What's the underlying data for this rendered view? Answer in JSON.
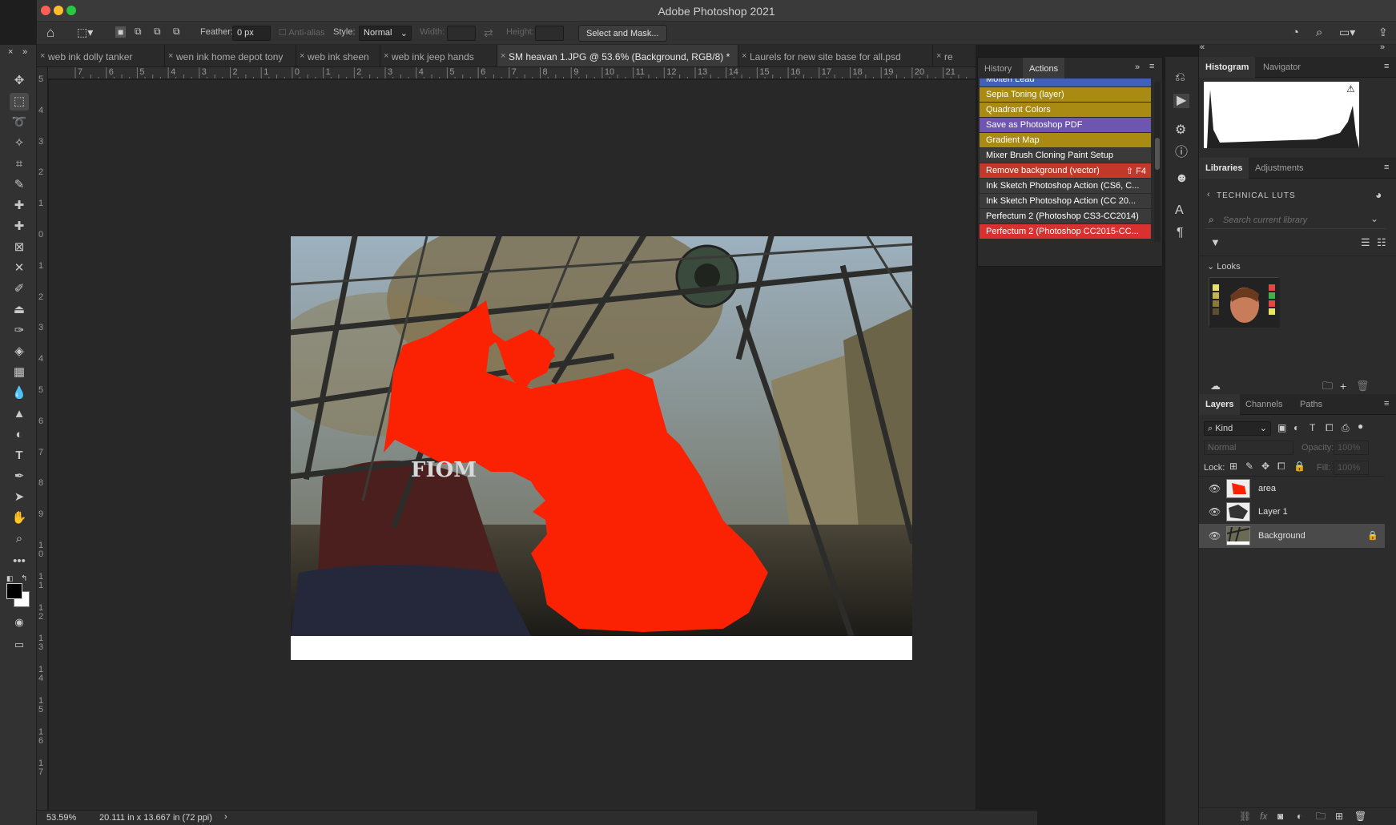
{
  "app": {
    "title": "Adobe Photoshop 2021"
  },
  "options": {
    "feather_label": "Feather:",
    "feather_value": "0 px",
    "antialias_label": "Anti-alias",
    "style_label": "Style:",
    "style_value": "Normal",
    "width_label": "Width:",
    "height_label": "Height:",
    "select_mask_label": "Select and Mask..."
  },
  "tabs": [
    {
      "label": "web ink dolly tanker",
      "active": false
    },
    {
      "label": "wen ink home depot tony",
      "active": false
    },
    {
      "label": "web ink sheen",
      "active": false
    },
    {
      "label": "web ink jeep hands",
      "active": false
    },
    {
      "label": "SM heavan 1.JPG @ 53.6% (Background, RGB/8) *",
      "active": true
    },
    {
      "label": "Laurels for new site base for all.psd",
      "active": false
    },
    {
      "label": "re",
      "active": false
    }
  ],
  "ruler": {
    "h": [
      "7",
      "6",
      "5",
      "4",
      "3",
      "2",
      "1",
      "0",
      "1",
      "2",
      "3",
      "4",
      "5",
      "6",
      "7",
      "8",
      "9",
      "10",
      "11",
      "12",
      "13",
      "14",
      "15",
      "16",
      "17",
      "18",
      "19",
      "20",
      "21"
    ],
    "v": [
      "5",
      "4",
      "3",
      "2",
      "1",
      "0",
      "1",
      "2",
      "3",
      "4",
      "5",
      "6",
      "7",
      "8",
      "9",
      "1 0",
      "1 1",
      "1 2",
      "1 3",
      "1 4",
      "1 5",
      "1 6",
      "1 7"
    ]
  },
  "status": {
    "zoom": "53.59%",
    "doc_size": "20.111 in x 13.667 in (72 ppi)"
  },
  "actions_panel": {
    "tabs": [
      "History",
      "Actions"
    ],
    "items": [
      {
        "label": "Molten Lead",
        "color": "#3f62b8"
      },
      {
        "label": "Sepia Toning (layer)",
        "color": "#a98a12"
      },
      {
        "label": "Quadrant Colors",
        "color": "#a98a12"
      },
      {
        "label": "Save as Photoshop PDF",
        "color": "#6d55b0"
      },
      {
        "label": "Gradient Map",
        "color": "#a98a12"
      },
      {
        "label": "Mixer Brush Cloning Paint Setup",
        "color": "#3a3a3a"
      },
      {
        "label": "Remove background (vector)",
        "color": "#c0392b",
        "shortcut": "⇧ F4"
      },
      {
        "label": "Ink Sketch Photoshop Action (CS6, C...",
        "color": "#3a3a3a"
      },
      {
        "label": "Ink Sketch Photoshop Action  (CC 20...",
        "color": "#3a3a3a"
      },
      {
        "label": "Perfectum 2 (Photoshop CS3-CC2014)",
        "color": "#3a3a3a"
      },
      {
        "label": "Perfectum 2 (Photoshop CC2015-CC...",
        "color": "#d93030"
      }
    ]
  },
  "histogram_panel": {
    "tabs": [
      "Histogram",
      "Navigator"
    ]
  },
  "libraries_panel": {
    "tabs": [
      "Libraries",
      "Adjustments"
    ],
    "library_name": "TECHNICAL LUTS",
    "search_placeholder": "Search current library",
    "section": "Looks"
  },
  "layers_panel": {
    "tabs": [
      "Layers",
      "Channels",
      "Paths"
    ],
    "kind_label": "Kind",
    "blend_mode": "Normal",
    "opacity_label": "Opacity:",
    "opacity_value": "100%",
    "lock_label": "Lock:",
    "fill_label": "Fill:",
    "fill_value": "100%",
    "layers": [
      {
        "name": "area"
      },
      {
        "name": "Layer 1"
      },
      {
        "name": "Background"
      }
    ]
  }
}
